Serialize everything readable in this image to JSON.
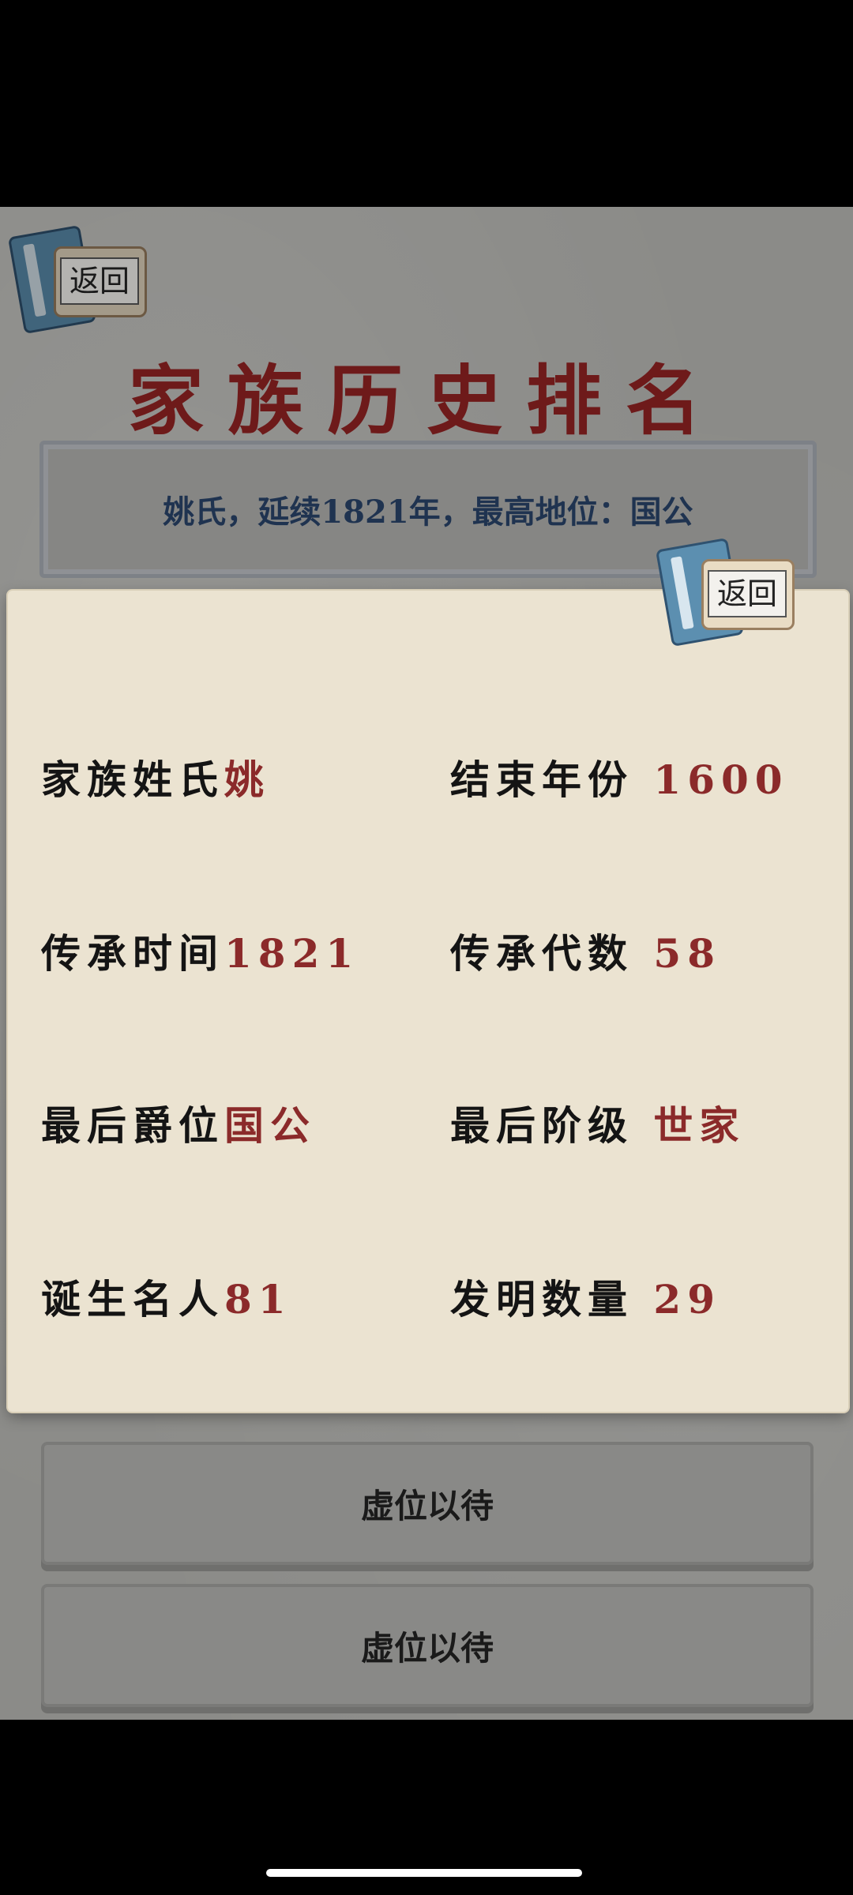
{
  "background": {
    "back_label": "返回",
    "title": "家族历史排名",
    "summary": "姚氏，延续1821年，最高地位：国公",
    "slots": [
      "虚位以待",
      "虚位以待"
    ]
  },
  "modal": {
    "back_label": "返回",
    "stats": [
      {
        "label": "家族姓氏",
        "value": "姚"
      },
      {
        "label": "结束年份",
        "value": "1600"
      },
      {
        "label": "传承时间",
        "value": "1821"
      },
      {
        "label": "传承代数",
        "value": "58"
      },
      {
        "label": "最后爵位",
        "value": "国公"
      },
      {
        "label": "最后阶级",
        "value": "世家"
      },
      {
        "label": "诞生名人",
        "value": "81"
      },
      {
        "label": "发明数量",
        "value": "29"
      }
    ]
  },
  "colors": {
    "title": "#6e1a1a",
    "value": "#8b2a2a",
    "summary": "#1f3350",
    "panel": "#ebe3d1"
  }
}
